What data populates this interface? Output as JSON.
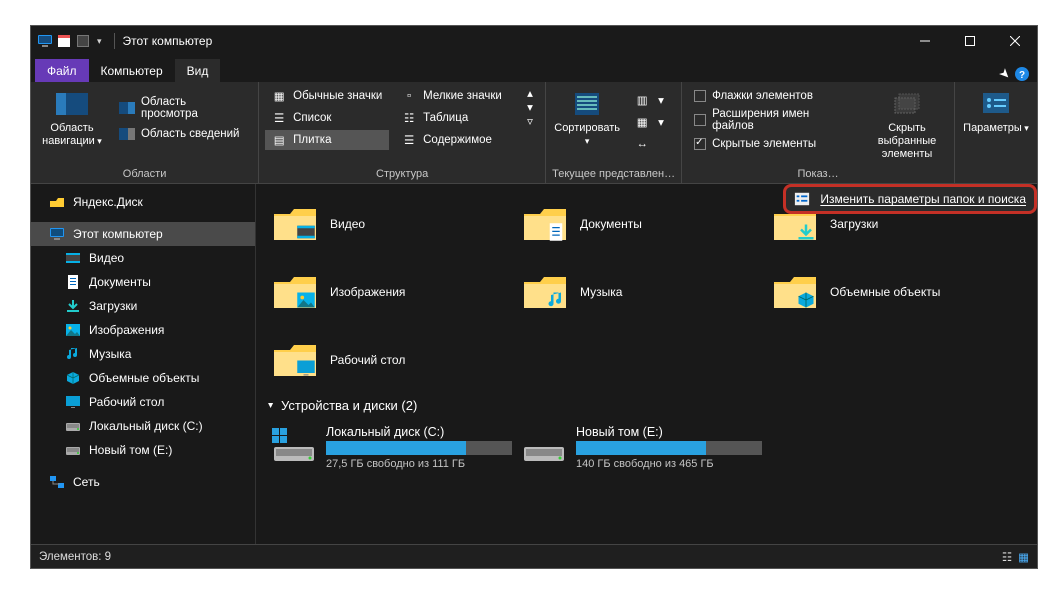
{
  "title": "Этот компьютер",
  "tabs": {
    "file": "Файл",
    "computer": "Компьютер",
    "view": "Вид"
  },
  "ribbon": {
    "panes": {
      "label": "Области",
      "navpane": "Область навигации",
      "preview": "Область просмотра",
      "details": "Область сведений"
    },
    "layout": {
      "label": "Структура",
      "normal": "Обычные значки",
      "small": "Мелкие значки",
      "list": "Список",
      "table": "Таблица",
      "tiles": "Плитка",
      "content": "Содержимое"
    },
    "current": {
      "label": "Текущее представлен…",
      "sort": "Сортировать"
    },
    "showhide": {
      "cb1": "Флажки элементов",
      "cb2": "Расширения имен файлов",
      "cb3": "Скрытые элементы",
      "hidebtn": "Скрыть выбранные элементы",
      "label": "Показ…"
    },
    "options": {
      "label": "Параметры"
    }
  },
  "popup": {
    "text": "Изменить параметры папок и поиска"
  },
  "nav": [
    {
      "depth": 0,
      "icon": "yadisk",
      "label": "Яндекс.Диск"
    },
    {
      "depth": 0,
      "icon": "pc",
      "label": "Этот компьютер",
      "selected": true
    },
    {
      "depth": 1,
      "icon": "video",
      "label": "Видео"
    },
    {
      "depth": 1,
      "icon": "doc",
      "label": "Документы"
    },
    {
      "depth": 1,
      "icon": "download",
      "label": "Загрузки"
    },
    {
      "depth": 1,
      "icon": "picture",
      "label": "Изображения"
    },
    {
      "depth": 1,
      "icon": "music",
      "label": "Музыка"
    },
    {
      "depth": 1,
      "icon": "3d",
      "label": "Объемные объекты"
    },
    {
      "depth": 1,
      "icon": "desktop",
      "label": "Рабочий стол"
    },
    {
      "depth": 1,
      "icon": "disk",
      "label": "Локальный диск (C:)"
    },
    {
      "depth": 1,
      "icon": "disk",
      "label": "Новый том (E:)"
    },
    {
      "depth": 0,
      "icon": "net",
      "label": "Сеть"
    }
  ],
  "folders": [
    {
      "icon": "video",
      "label": "Видео"
    },
    {
      "icon": "doc",
      "label": "Документы"
    },
    {
      "icon": "download",
      "label": "Загрузки"
    },
    {
      "icon": "picture",
      "label": "Изображения"
    },
    {
      "icon": "music",
      "label": "Музыка"
    },
    {
      "icon": "3d",
      "label": "Объемные объекты"
    },
    {
      "icon": "desktop",
      "label": "Рабочий стол"
    }
  ],
  "drives_header": "Устройства и диски (2)",
  "drives": [
    {
      "name": "Локальный диск (C:)",
      "fill": 75,
      "free": "27,5 ГБ свободно из 111 ГБ",
      "os": true
    },
    {
      "name": "Новый том (E:)",
      "fill": 70,
      "free": "140 ГБ свободно из 465 ГБ",
      "os": false
    }
  ],
  "status": {
    "count": "Элементов: 9"
  }
}
